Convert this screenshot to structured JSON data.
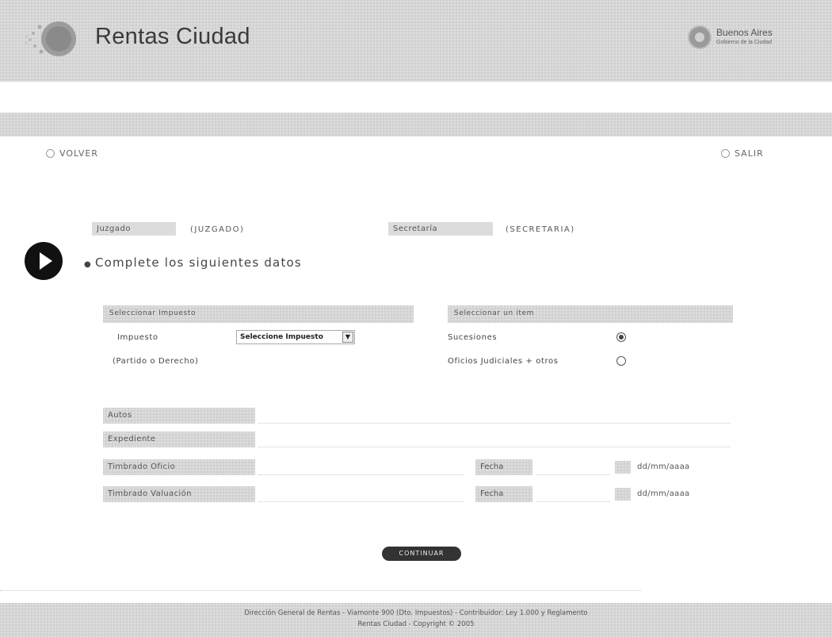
{
  "header": {
    "title": "Rentas Ciudad",
    "ba_logo_name": "Buenos Aires",
    "ba_logo_sub": "Gobierno de la Ciudad"
  },
  "nav": {
    "back_label": "VOLVER",
    "exit_label": "SALIR"
  },
  "court": {
    "juzgado_label": "Juzgado",
    "juzgado_value": "(JUZGADO)",
    "secretaria_label": "Secretaría",
    "secretaria_value": "(SECRETARIA)"
  },
  "section": {
    "heading": "Complete los siguientes datos"
  },
  "impuesto_box": {
    "title": "Seleccionar Impuesto",
    "impuesto_label": "Impuesto",
    "select_value": "Seleccione Impuesto",
    "partido_text": "(Partido o Derecho)"
  },
  "items_box": {
    "title": "Seleccionar un item",
    "options": [
      {
        "label": "Sucesiones",
        "selected": true
      },
      {
        "label": "Oficios Judiciales + otros",
        "selected": false
      }
    ]
  },
  "form": {
    "autos_label": "Autos",
    "autos_value": "",
    "expediente_label": "Expediente",
    "expediente_value": "",
    "timbrado_oficio_label": "Timbrado Oficio",
    "timbrado_oficio_value": "",
    "timbrado_valuacion_label": "Timbrado Valuación",
    "timbrado_valuacion_value": "",
    "fecha_label": "Fecha",
    "fecha1_value": "",
    "fecha2_value": "",
    "date_hint": "dd/mm/aaaa"
  },
  "actions": {
    "submit_label": "CONTINUAR"
  },
  "footer": {
    "line1": "Dirección General de Rentas - Viamonte 900 (Dto. Impuestos) - Contribuidor: Ley 1.000 y Reglamento",
    "line2": "Rentas Ciudad - Copyright © 2005"
  },
  "colors": {
    "pattern_bg": "#d6d6d6",
    "button_bg": "#333333",
    "play_icon": "#111111"
  },
  "icons": {
    "logo": "rentas-globe-logo",
    "section_marker": "play-circle-icon",
    "nav": "circle-icon"
  }
}
